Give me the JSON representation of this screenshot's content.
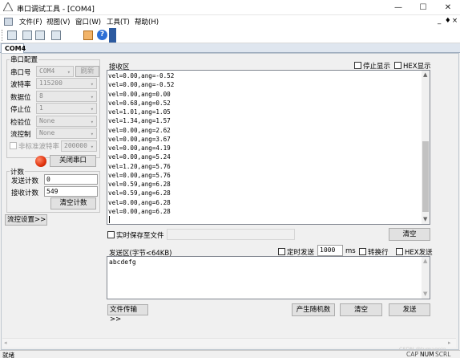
{
  "window": {
    "title": "串口调试工具 - [COM4]",
    "minimize": "—",
    "maximize": "☐",
    "close": "✕"
  },
  "menu": {
    "items": [
      "文件(F)",
      "视图(V)",
      "窗口(W)",
      "工具(T)",
      "帮助(H)"
    ],
    "right": [
      "_",
      "♦",
      "×"
    ]
  },
  "toolbar": {
    "icons": [
      "console-icon",
      "split-h-icon",
      "split-v-icon",
      "save-icon",
      "config-icon",
      "help-icon"
    ]
  },
  "tab": {
    "label": "COM4"
  },
  "port_config": {
    "group_label": "串口配置",
    "port": {
      "label": "串口号",
      "value": "COM4",
      "refresh": "刷新"
    },
    "baud": {
      "label": "波特率",
      "value": "115200"
    },
    "databits": {
      "label": "数据位",
      "value": "8"
    },
    "stopbits": {
      "label": "停止位",
      "value": "1"
    },
    "parity": {
      "label": "检验位",
      "value": "None"
    },
    "flow": {
      "label": "流控制",
      "value": "None"
    },
    "nonstd": {
      "label": "非标准波特率",
      "value": "200000"
    },
    "close_button": "关闭串口"
  },
  "counts": {
    "group_label": "计数",
    "sent_label": "发送计数",
    "sent": "0",
    "recv_label": "接收计数",
    "recv": "549",
    "clear": "清空计数"
  },
  "flow_settings": "流控设置>>",
  "receive": {
    "label": "接收区",
    "stop_display": "停止显示",
    "hex_display": "HEX显示",
    "lines": [
      "vel=0.00,ang=-0.52",
      "vel=0.00,ang=-0.52",
      "vel=0.00,ang=0.00",
      "vel=0.68,ang=0.52",
      "vel=1.01,ang=1.05",
      "vel=1.34,ang=1.57",
      "vel=0.00,ang=2.62",
      "vel=0.00,ang=3.67",
      "vel=0.00,ang=4.19",
      "vel=0.00,ang=5.24",
      "vel=1.20,ang=5.76",
      "vel=0.00,ang=5.76",
      "vel=0.59,ang=6.28",
      "vel=0.59,ang=6.28",
      "vel=0.00,ang=6.28",
      "vel=0.00,ang=6.28"
    ]
  },
  "save_file": {
    "label": "实时保存至文件",
    "path": "",
    "clear": "清空"
  },
  "send": {
    "label": "发送区(字节<64KB)",
    "timed": "定时发送",
    "interval": "1000",
    "unit": "ms",
    "newline": "转换行",
    "hex": "HEX发送",
    "content": "abcdefg"
  },
  "bottom": {
    "file_transfer": "文件传输>>",
    "random": "产生随机数",
    "clear": "清空",
    "send": "发送"
  },
  "status": {
    "left": "就绪",
    "indicators": [
      "CAP",
      "NUM",
      "SCRL"
    ],
    "watermark": "CSDN @tumagpig"
  }
}
